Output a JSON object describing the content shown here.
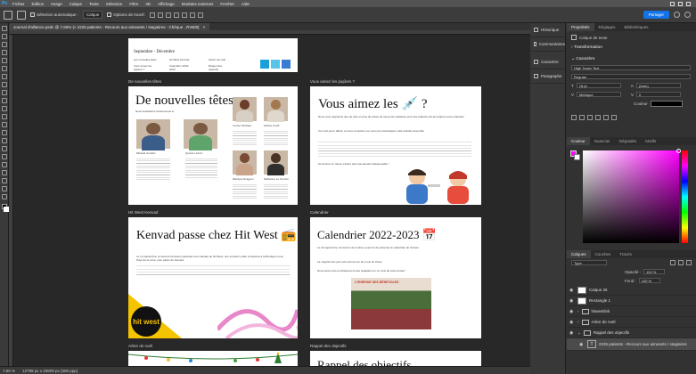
{
  "app": {
    "menu": [
      "Fichier",
      "Edition",
      "Image",
      "Calque",
      "Texte",
      "Sélection",
      "Filtre",
      "3D",
      "Affichage",
      "Modules externes",
      "Fenêtre",
      "Aide"
    ]
  },
  "options": {
    "autoselect": "Sélection automatique :",
    "autoselect_value": "Calque",
    "transform": "Options de transf.",
    "share": "Partager"
  },
  "document": {
    "tab_title": "Journal d'alliance.psdc @ 7,65% (« 2225 patients - Recours aux aimeants / stagiaires - Chèque , RVB/8)",
    "zoom": "7,65 %",
    "size": "12799 px x 23609 px (300 ppp)"
  },
  "canvas": {
    "top_page": {
      "label_line1": "Septembre - Décembre",
      "cells": [
        "Les nouvelles têtes",
        "Hit West Kenvad",
        "Action de noël",
        "Vous aimez les piqûres ?",
        "Calendrier 2022-2023",
        "Rappel des objectifs"
      ]
    },
    "sections": {
      "s1": "De nouvelles têtes",
      "s2": "Vous aimez les piqûres ?",
      "s3": "Hit West Kenvad",
      "s4": "Calendrier",
      "s5": "Arbre de noël",
      "s6": "Rappel des objectifs"
    },
    "p1": {
      "title": "De nouvelles têtes",
      "intro": "Nous souhaitons la bienvenue à :",
      "people": [
        {
          "name": "Mickaël Goutfier"
        },
        {
          "name": "Quentin Jumin"
        },
        {
          "name": "Louise Nicolaes"
        },
        {
          "name": "Karline Coeff"
        },
        {
          "name": "Marilyne Dragonn"
        },
        {
          "name": "Nathanne Le Tournin"
        }
      ]
    },
    "p2": {
      "title": "Vous aimez les 💉 ?",
      "text1": "Nous vous rappelons que de plus en plus de prises de sang sont réalisées pour des patients par les piqûres sous-cutanées.",
      "text2": "Ce n'est qu'un début, et nous comptons sur vous pour développer cette activité ensemble.",
      "text3": "Se donner un retour s'avère plus que jamais indispensable !"
    },
    "p3": {
      "title": "Kenvad passe chez Hit West 📻",
      "text1": "Le 14 septembre, le docteur Kenvad a participé à la matinale de Hit West, une émission radio consacrée à la Bretagne et au Pays de la Loire, pour parler de Kenvad.",
      "logo": "hit west"
    },
    "p4": {
      "title": "Calendrier 2022-2023 📅",
      "text1": "Le 22 septembre, la réunion de rentrée a permis de présenter le calendrier de l'année.",
      "text2": "La majorité des pics sont prévus sur les mois de l'hiver.",
      "text3": "Nous avons très prochainement des stagiaires en ce mois de cette année !",
      "poster": "L'ENERGIE DES BÉNÉVOLES"
    },
    "p5": {},
    "p6": {
      "title": "Rappel des objectifs"
    }
  },
  "panels": {
    "strip": [
      "Historique",
      "Commentaires",
      "Caractère",
      "Paragraphe"
    ],
    "properties_tabs": [
      "Propriétés",
      "Réglages",
      "Bibliothèques"
    ],
    "layer_kind": "Calque de texte",
    "transform_label": "Transformation",
    "character_label": "Caractère",
    "font": "High Tower Text",
    "style": "Regular",
    "size": "18 pt",
    "leading": "(Auto)",
    "kerning": "Métrique",
    "tracking": "0",
    "color_label": "Couleur",
    "color_tabs": [
      "Couleur",
      "Nuancier",
      "Dégradés",
      "Motifs"
    ],
    "layers_tabs": [
      "Calques",
      "Couches",
      "Tracés"
    ],
    "layers_filter": "Type",
    "opacity_label": "Opacité :",
    "opacity": "100 %",
    "fill_label": "Fond :",
    "fill": "100 %",
    "layers": [
      {
        "name": "Calque 26",
        "type": "thumb"
      },
      {
        "name": "Rectangle 1",
        "type": "thumb"
      },
      {
        "name": "hitwestlink",
        "type": "group"
      },
      {
        "name": "Arbre de noël",
        "type": "group"
      },
      {
        "name": "Rappel des objectifs",
        "type": "group"
      },
      {
        "name": "2225 patients - Recours aux aimeants / stagiaires - Chèque",
        "type": "text"
      }
    ],
    "colors": {
      "fg": "#ff00ff",
      "accent": "#1473e6"
    }
  }
}
